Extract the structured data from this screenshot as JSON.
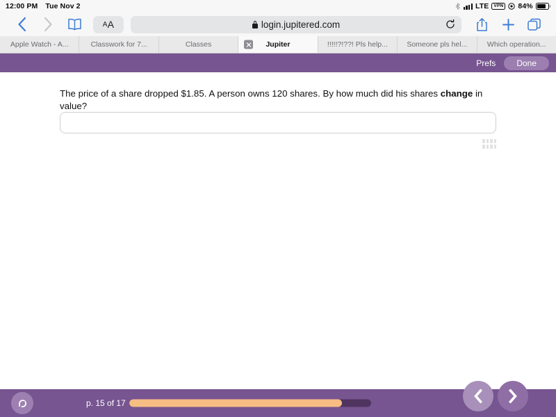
{
  "status_bar": {
    "time": "12:00 PM",
    "date": "Tue Nov 2",
    "network_label": "LTE",
    "vpn_label": "VPN",
    "battery_percent": "84%",
    "battery_level": 84,
    "icons": [
      "bluetooth-icon",
      "signal-bars-icon",
      "vpn-badge-icon",
      "location-icon",
      "battery-icon"
    ]
  },
  "browser": {
    "back_icon": "chevron-left-icon",
    "forward_icon": "chevron-right-icon",
    "bookmarks_icon": "book-icon",
    "text_size_small": "A",
    "text_size_large": "A",
    "url": "login.jupitered.com",
    "lock_icon": "lock-icon",
    "reload_icon": "reload-icon",
    "share_icon": "share-icon",
    "new_tab_icon": "plus-icon",
    "tabs_overview_icon": "tabs-icon",
    "tabs": [
      {
        "label": "Apple Watch - A...",
        "active": false
      },
      {
        "label": "Classwork for 7...",
        "active": false
      },
      {
        "label": "Classes",
        "active": false
      },
      {
        "label": "Jupiter",
        "active": true
      },
      {
        "label": "!!!!!?!??! Pls help...",
        "active": false
      },
      {
        "label": "Someone pls hel...",
        "active": false
      },
      {
        "label": "Which operation...",
        "active": false
      }
    ]
  },
  "app_header": {
    "prefs_label": "Prefs",
    "done_label": "Done"
  },
  "quiz": {
    "question_part1": "The price of a share dropped $1.85. A person owns 120 shares. By how much did his shares ",
    "question_emphasis": "change",
    "question_part2": " in value?",
    "answer_value": "",
    "answer_placeholder": ""
  },
  "footer": {
    "logo_letter": "e",
    "page_label": "p. 15 of 17",
    "current_page": 15,
    "total_pages": 17,
    "progress_percent": 88,
    "prev_icon": "chevron-left-icon",
    "next_icon": "chevron-right-icon"
  },
  "colors": {
    "brand_purple": "#775590",
    "progress_orange": "#f7bd83",
    "progress_track": "#4f3460",
    "safari_blue": "#3b7cd3"
  }
}
